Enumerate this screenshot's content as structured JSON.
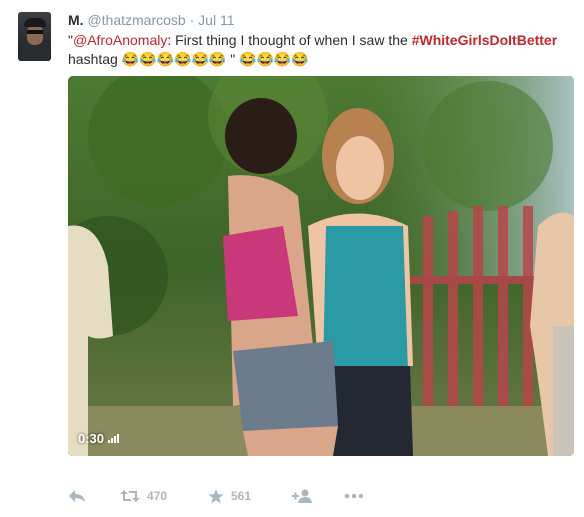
{
  "user": {
    "fullname": "M.",
    "screenname": "@thatzmarcosb",
    "separator": "·",
    "time": "Jul 11"
  },
  "tweet": {
    "open_quote": "\"",
    "mention": "@AfroAnomaly",
    "text_before_hashtag": ": First thing I thought of when I saw the ",
    "hashtag": "#WhiteGirlsDoItBetter",
    "text_line2": "hashtag ",
    "emoji_run_1": "😂😂😂😂😂😂",
    "closing_quote": " \" ",
    "emoji_run_2": "😂😂😂😂"
  },
  "media": {
    "duration": "0:30",
    "kind": "video",
    "icon": "volume-bars-icon"
  },
  "actions": {
    "reply_icon": "reply-icon",
    "retweet_icon": "retweet-icon",
    "retweet_count": "470",
    "favorite_icon": "star-icon",
    "favorite_count": "561",
    "follow_icon": "follow-icon",
    "more_icon": "more-icon"
  },
  "colors": {
    "link_red": "#c1272d",
    "muted": "#8899a6",
    "action_gray": "#aab8c2",
    "text": "#292f33"
  }
}
